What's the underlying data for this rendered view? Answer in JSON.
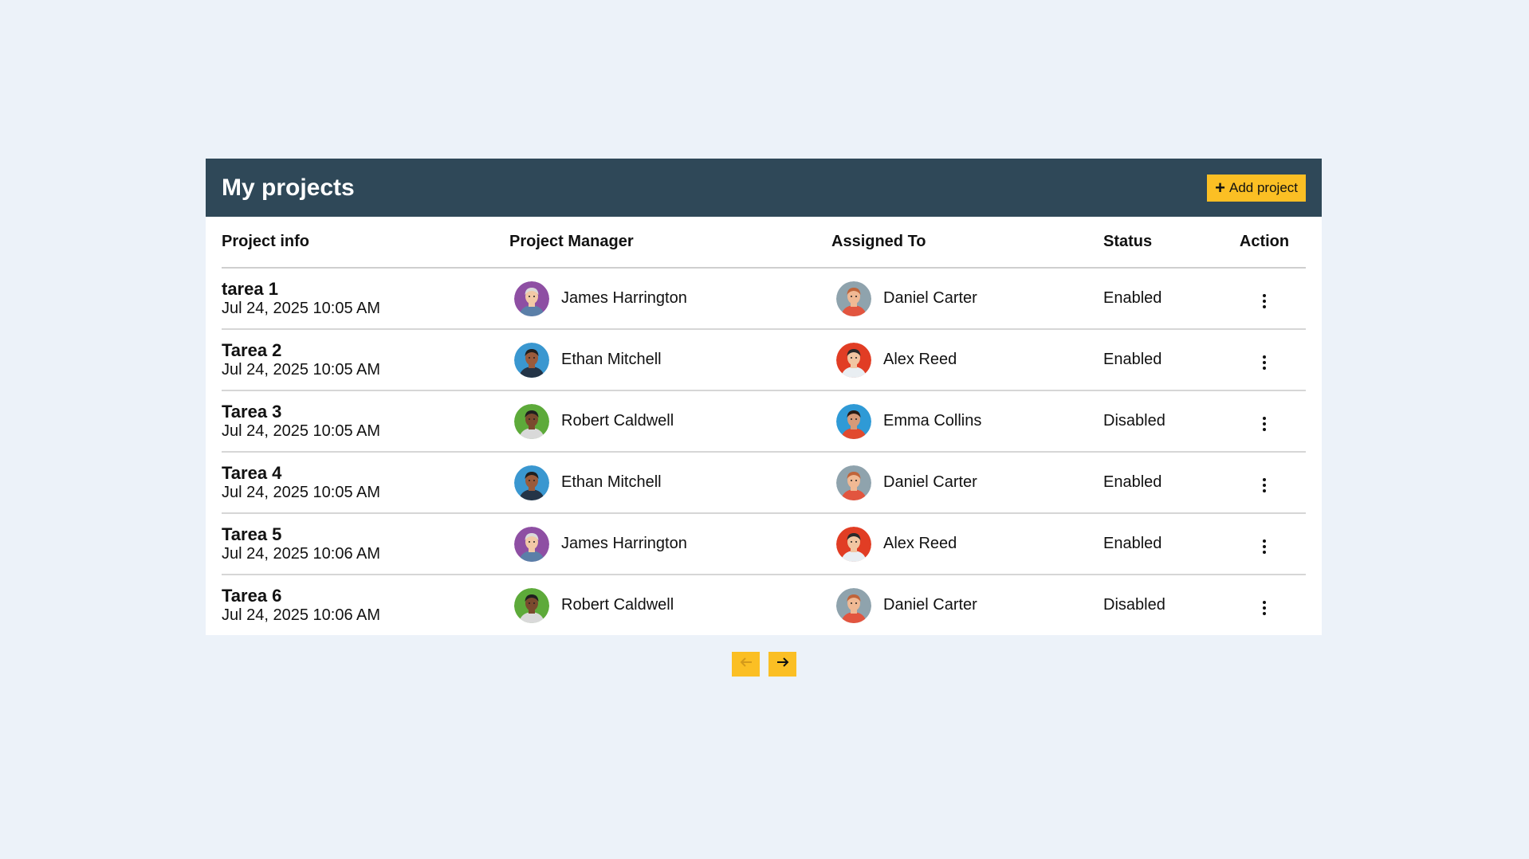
{
  "header": {
    "title": "My projects",
    "add_button_label": "Add project"
  },
  "table": {
    "columns": [
      "Project info",
      "Project Manager",
      "Assigned To",
      "Status",
      "Action"
    ],
    "rows": [
      {
        "name": "tarea 1",
        "date": "Jul 24, 2025 10:05 AM",
        "manager": "James Harrington",
        "assigned": "Daniel Carter",
        "status": "Enabled"
      },
      {
        "name": "Tarea 2",
        "date": "Jul 24, 2025 10:05 AM",
        "manager": "Ethan Mitchell",
        "assigned": "Alex Reed",
        "status": "Enabled"
      },
      {
        "name": "Tarea 3",
        "date": "Jul 24, 2025 10:05 AM",
        "manager": "Robert Caldwell",
        "assigned": "Emma Collins",
        "status": "Disabled"
      },
      {
        "name": "Tarea 4",
        "date": "Jul 24, 2025 10:05 AM",
        "manager": "Ethan Mitchell",
        "assigned": "Daniel Carter",
        "status": "Enabled"
      },
      {
        "name": "Tarea 5",
        "date": "Jul 24, 2025 10:06 AM",
        "manager": "James Harrington",
        "assigned": "Alex Reed",
        "status": "Enabled"
      },
      {
        "name": "Tarea 6",
        "date": "Jul 24, 2025 10:06 AM",
        "manager": "Robert Caldwell",
        "assigned": "Daniel Carter",
        "status": "Disabled"
      }
    ]
  },
  "pagination": {
    "prev_icon": "arrow-left-icon",
    "next_icon": "arrow-right-icon"
  },
  "colors": {
    "header_bg": "#2f4858",
    "accent": "#fbbf24",
    "page_bg": "#ecf2f9"
  }
}
